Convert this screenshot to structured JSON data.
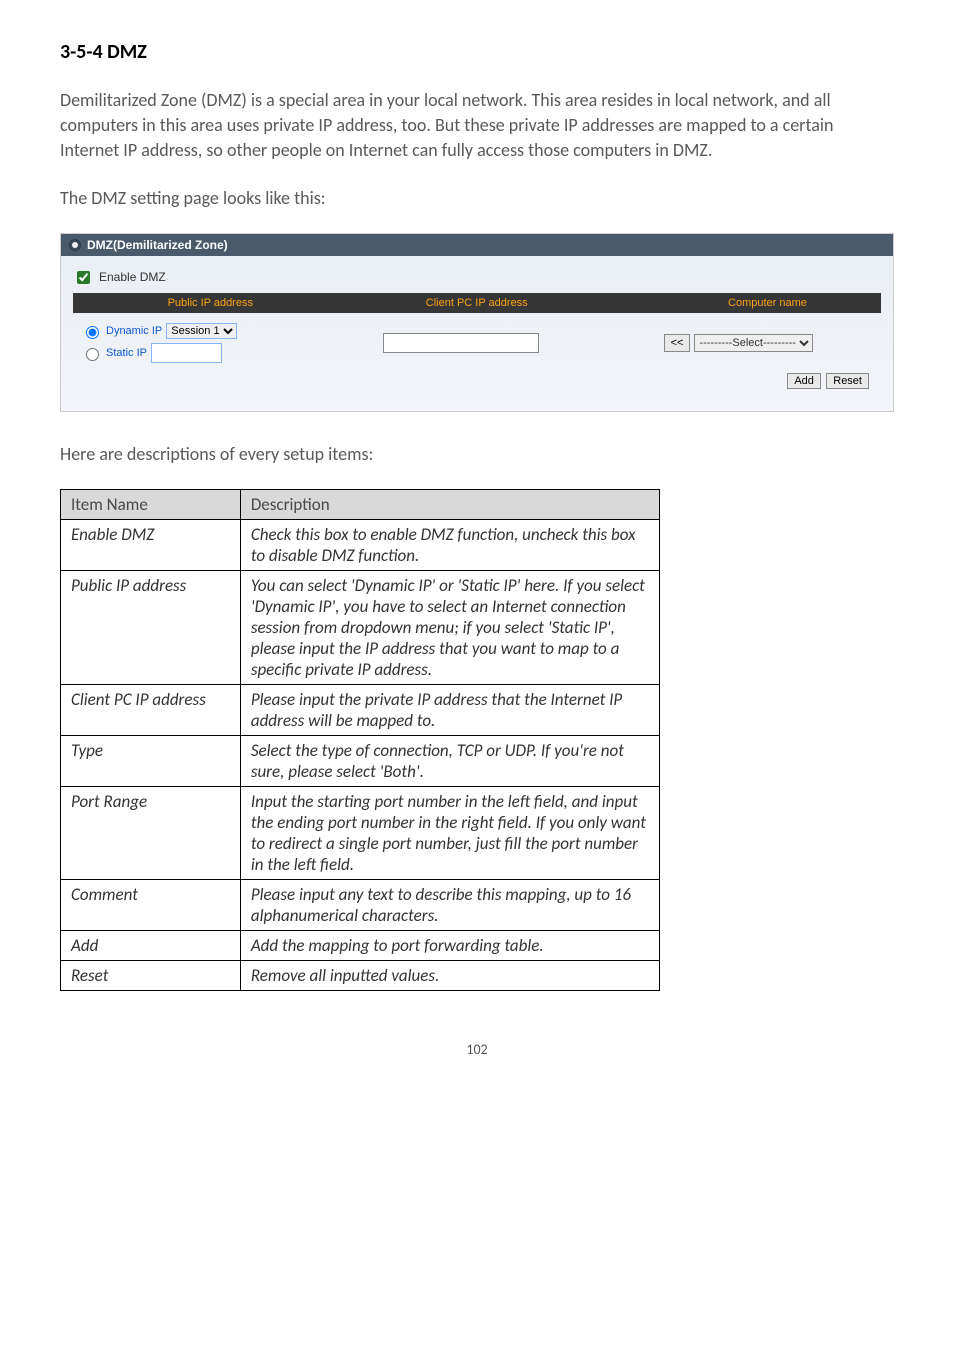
{
  "section_title": "3-5-4 DMZ",
  "intro_para": "Demilitarized Zone (DMZ) is a special area in your local network. This area resides in local network, and all computers in this area uses private IP address, too. But these private IP addresses are mapped to a certain Internet IP address, so other people on Internet can fully access those computers in DMZ.",
  "lead_in": "The DMZ setting page looks like this:",
  "panel": {
    "title": "DMZ(Demilitarized Zone)",
    "enable_label": "Enable DMZ",
    "columns": {
      "public": "Public IP address",
      "client": "Client PC IP address",
      "name": "Computer name"
    },
    "dynamic_label": "Dynamic IP",
    "dynamic_value": "Session 1",
    "static_label": "Static IP",
    "back_btn": "<<",
    "select_placeholder": "---------Select---------",
    "add_btn": "Add",
    "reset_btn": "Reset"
  },
  "here_are": "Here are descriptions of every setup items:",
  "table": {
    "head_item": "Item Name",
    "head_desc": "Description",
    "rows": [
      {
        "label": "Enable DMZ",
        "italic": true,
        "desc": "Check this box to enable DMZ function, uncheck this box to disable DMZ function."
      },
      {
        "label": "Public IP address",
        "italic": true,
        "desc": "You can select 'Dynamic IP' or 'Static IP' here. If you select 'Dynamic IP', you have to select an Internet connection session from dropdown menu; if you select 'Static IP', please input the IP address that you want to map to a specific private IP address."
      },
      {
        "label": "Client PC IP address",
        "italic": true,
        "desc": "Please input the private IP address that the Internet IP address will be mapped to."
      },
      {
        "label": "Type",
        "italic": true,
        "desc": "Select the type of connection, TCP or UDP. If you're not sure, please select 'Both'."
      },
      {
        "label": "Port Range",
        "italic": true,
        "desc": "Input the starting port number in the left field, and input the ending port number in the right field. If you only want to redirect a single port number, just fill the port number in the left field."
      },
      {
        "label": "Comment",
        "italic": true,
        "desc": "Please input any text to describe this mapping, up to 16 alphanumerical characters."
      },
      {
        "label": "Add",
        "italic": true,
        "desc": "Add the mapping to port forwarding table."
      },
      {
        "label": "Reset",
        "italic": true,
        "desc": "Remove all inputted values."
      }
    ]
  },
  "page_number": "102"
}
